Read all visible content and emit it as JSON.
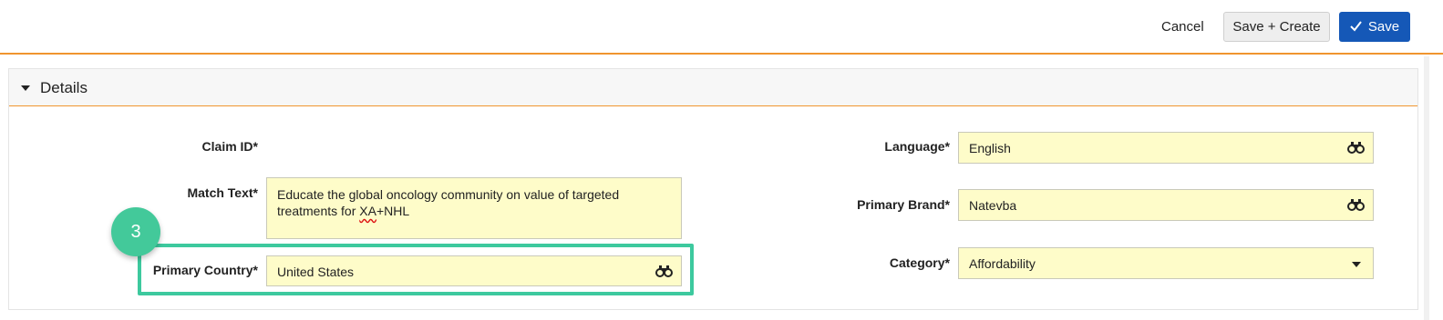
{
  "toolbar": {
    "cancel_label": "Cancel",
    "save_create_label": "Save + Create",
    "save_label": "Save",
    "accent_color": "#f0952f",
    "primary_button_color": "#1558b7"
  },
  "section": {
    "title": "Details",
    "expanded": true
  },
  "fields_left": {
    "claim_id": {
      "label": "Claim ID*",
      "value": ""
    },
    "match_text": {
      "label": "Match Text*",
      "value_part1": "Educate the global oncology community on value of targeted treatments for ",
      "value_misspelled": "XA",
      "value_part2": "+NHL"
    },
    "primary_country": {
      "label": "Primary Country*",
      "value": "United States",
      "icon": "binoculars-icon"
    }
  },
  "fields_right": {
    "language": {
      "label": "Language*",
      "value": "English",
      "icon": "binoculars-icon"
    },
    "primary_brand": {
      "label": "Primary Brand*",
      "value": "Natevba",
      "icon": "binoculars-icon"
    },
    "category": {
      "label": "Category*",
      "value": "Affordability",
      "icon": "chevron-down-icon"
    }
  },
  "annotation": {
    "step_number": "3",
    "highlight_color": "#3dc99e",
    "field_bg_color": "#fefcc9"
  }
}
